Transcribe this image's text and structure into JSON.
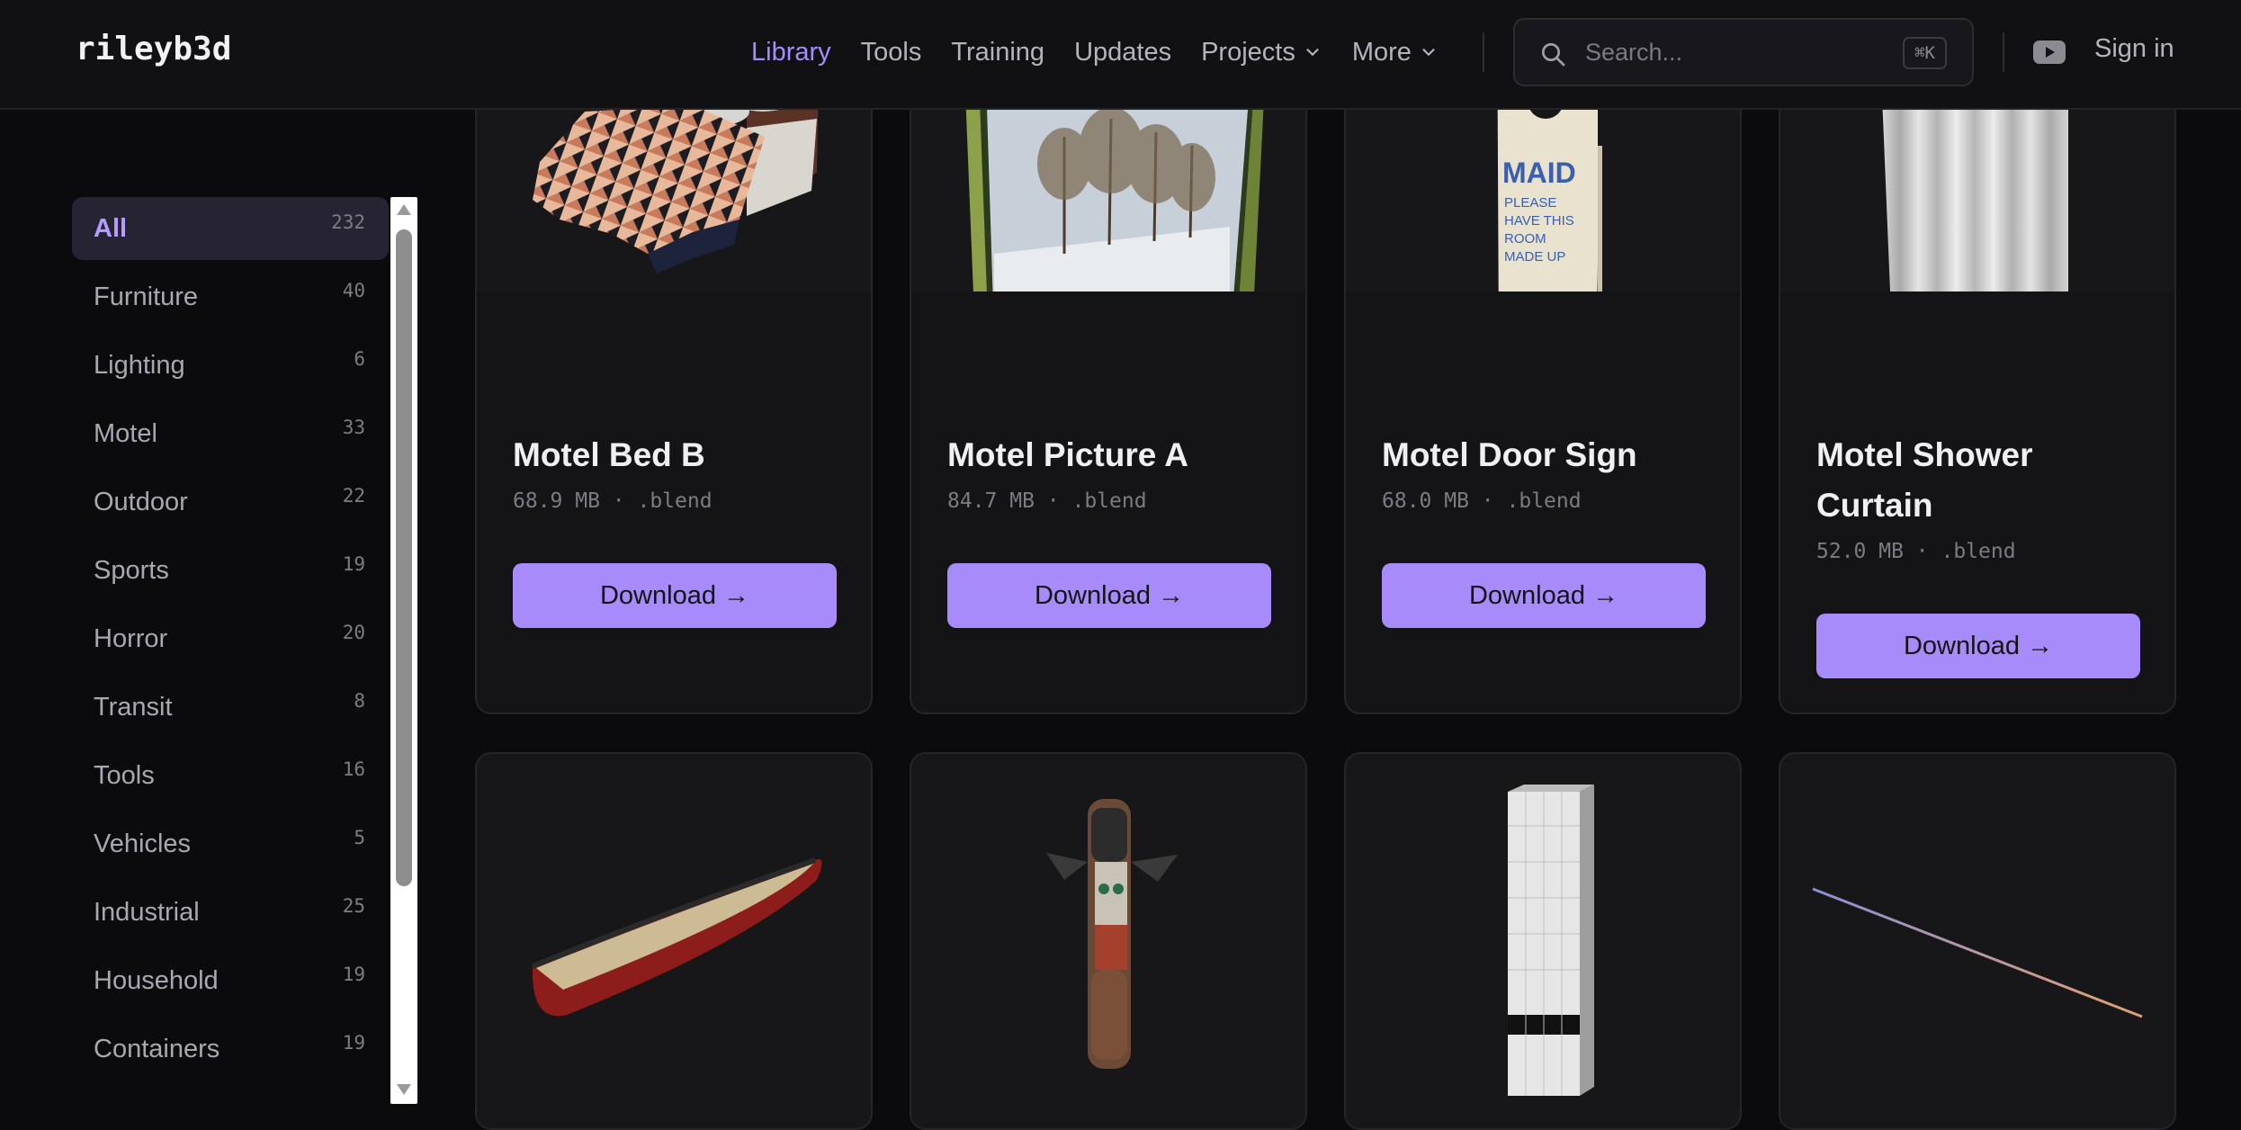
{
  "header": {
    "logo": "rileyb3d",
    "nav": [
      {
        "label": "Library",
        "active": true
      },
      {
        "label": "Tools"
      },
      {
        "label": "Training"
      },
      {
        "label": "Updates"
      },
      {
        "label": "Projects",
        "has_dropdown": true
      },
      {
        "label": "More",
        "has_dropdown": true
      }
    ],
    "search": {
      "placeholder": "Search...",
      "shortcut": "⌘K"
    },
    "sign_in": "Sign in"
  },
  "sidebar": {
    "categories": [
      {
        "label": "All",
        "count": "232",
        "active": true
      },
      {
        "label": "Furniture",
        "count": "40"
      },
      {
        "label": "Lighting",
        "count": "6"
      },
      {
        "label": "Motel",
        "count": "33"
      },
      {
        "label": "Outdoor",
        "count": "22"
      },
      {
        "label": "Sports",
        "count": "19"
      },
      {
        "label": "Horror",
        "count": "20"
      },
      {
        "label": "Transit",
        "count": "8"
      },
      {
        "label": "Tools",
        "count": "16"
      },
      {
        "label": "Vehicles",
        "count": "5"
      },
      {
        "label": "Industrial",
        "count": "25"
      },
      {
        "label": "Household",
        "count": "19"
      },
      {
        "label": "Containers",
        "count": "19"
      }
    ]
  },
  "assets": [
    {
      "title": "Motel Bed B",
      "meta": "68.9 MB · .blend",
      "button": "Download →"
    },
    {
      "title": "Motel Picture A",
      "meta": "84.7 MB · .blend",
      "button": "Download →"
    },
    {
      "title": "Motel Door Sign",
      "meta": "68.0 MB · .blend",
      "button": "Download →"
    },
    {
      "title": "Motel Shower Curtain",
      "meta": "52.0 MB · .blend",
      "button": "Download →"
    }
  ],
  "door_sign_text": {
    "brand": "MAID",
    "message": "PLEASE HAVE THIS ROOM MADE UP"
  },
  "colors": {
    "accent": "#a78bfa",
    "background": "#0b0b0d",
    "card": "#141417"
  }
}
